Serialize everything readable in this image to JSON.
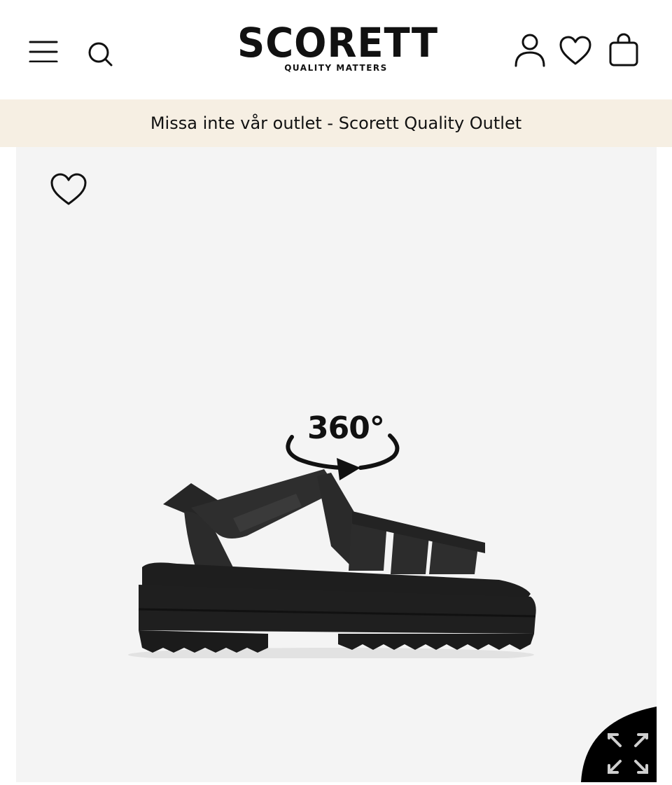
{
  "header": {
    "logo_text": "SCORETT",
    "logo_tagline": "QUALITY MATTERS",
    "icons": [
      "menu-icon",
      "search-icon",
      "account-icon",
      "wishlist-icon",
      "bag-icon"
    ]
  },
  "promo_banner": {
    "text": "Missa inte vår outlet - Scorett Quality Outlet",
    "background": "#f6efe3"
  },
  "gallery": {
    "background": "#f4f4f4",
    "badge_text": "360°",
    "icons": [
      "heart-icon",
      "expand-icon"
    ]
  }
}
